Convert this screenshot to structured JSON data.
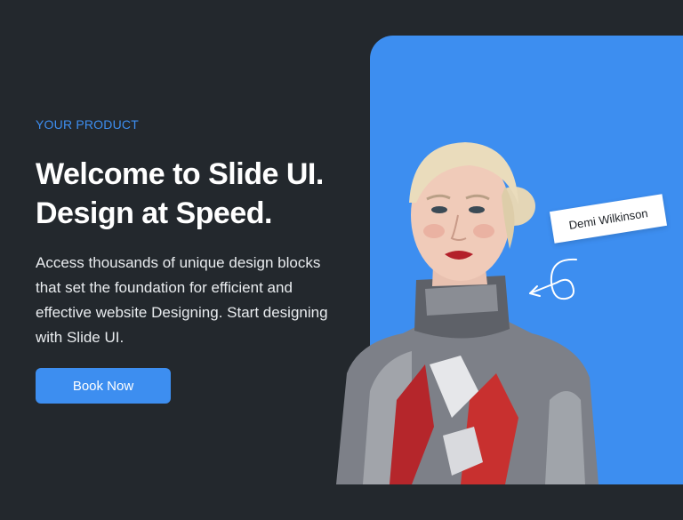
{
  "hero": {
    "eyebrow": "YOUR PRODUCT",
    "title_line1": "Welcome to Slide UI.",
    "title_line2": "Design at Speed.",
    "description": "Access thousands of unique design blocks that set the foundation for efficient and effective website Designing. Start designing with Slide UI.",
    "cta_label": "Book Now"
  },
  "showcase": {
    "name_tag": "Demi Wilkinson",
    "portrait_icon": "woman-portrait-image",
    "arrow_icon": "curved-arrow-icon"
  },
  "colors": {
    "background": "#23282d",
    "accent": "#3d8ef0",
    "text": "#ffffff"
  }
}
